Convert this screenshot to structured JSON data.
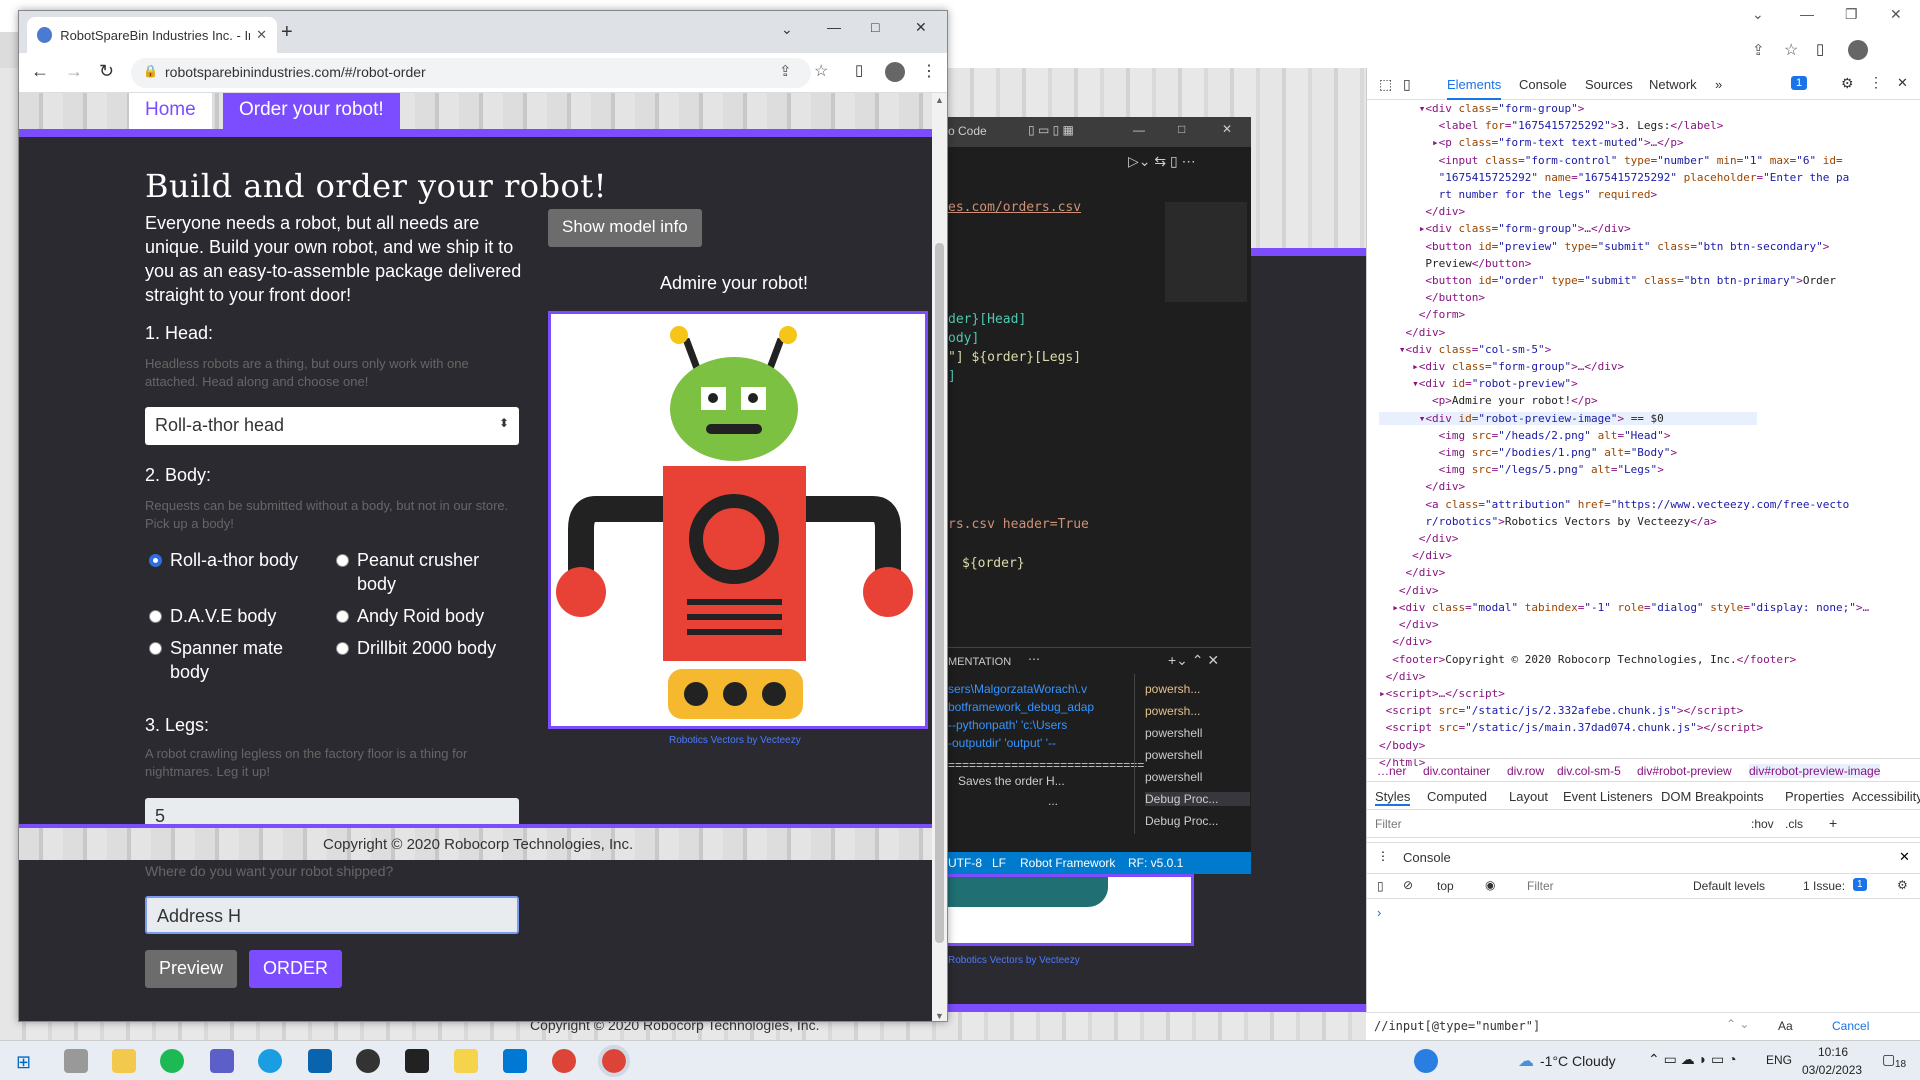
{
  "browser": {
    "tab_title": "RobotSpareBin Industries Inc. - In",
    "url": "robotsparebinindustries.com/#/robot-order",
    "nav_home": "Home",
    "nav_order": "Order your robot!"
  },
  "page": {
    "heading": "Build and order your robot!",
    "intro": "Everyone needs a robot, but all needs are unique. Build your own robot, and we ship it to you as an easy-to-assemble package delivered straight to your front door!",
    "show_model_info": "Show model info",
    "admire": "Admire your robot!",
    "attribution": "Robotics Vectors by Vecteezy",
    "head_label": "1. Head:",
    "head_help": "Headless robots are a thing, but ours only work with one attached. Head along and choose one!",
    "head_selected": "Roll-a-thor head",
    "body_label": "2. Body:",
    "body_help": "Requests can be submitted without a body, but not in our store. Pick up a body!",
    "bodies": [
      {
        "label": "Roll-a-thor body",
        "checked": true
      },
      {
        "label": "Peanut crusher body",
        "checked": false
      },
      {
        "label": "D.A.V.E body",
        "checked": false
      },
      {
        "label": "Andy Roid body",
        "checked": false
      },
      {
        "label": "Spanner mate body",
        "checked": false
      },
      {
        "label": "Drillbit 2000 body",
        "checked": false
      }
    ],
    "legs_label": "3. Legs:",
    "legs_help": "A robot crawling legless on the factory floor is a thing for nightmares. Leg it up!",
    "legs_value": "5",
    "address_help": "Where do you want your robot shipped?",
    "address_value": "Address H",
    "preview": "Preview",
    "order": "ORDER",
    "copyright": "Copyright © 2020 Robocorp Technologies, Inc."
  },
  "vscode": {
    "title": "o Code",
    "lines": [
      "es.com/orders.csv",
      "der}[Head]",
      "ody]",
      "\"]     ${order}[Legs]",
      "]",
      "rs.csv     header=True",
      "${order}"
    ],
    "panel_tab": "MENTATION",
    "terminal": [
      "sers\\MalgorzataWorach\\.v",
      "botframework_debug_adap",
      "--pythonpath' 'c:\\Users",
      "-outputdir' 'output' '--",
      "============================",
      "Saves the order H...",
      "..."
    ],
    "terminals": [
      "powersh...",
      "powersh...",
      "powershell",
      "powershell",
      "powershell",
      "Debug Proc...",
      "Debug Proc..."
    ],
    "status": [
      "UTF-8",
      "LF",
      "Robot Framework",
      "RF: v5.0.1"
    ]
  },
  "devtools": {
    "tabs": [
      "Elements",
      "Console",
      "Sources",
      "Network"
    ],
    "badge": "1",
    "breadcrumb": [
      "…ner",
      "div.container",
      "div.row",
      "div.col-sm-5",
      "div#robot-preview",
      "div#robot-preview-image"
    ],
    "style_tabs": [
      "Styles",
      "Computed",
      "Layout",
      "Event Listeners",
      "DOM Breakpoints",
      "Properties",
      "Accessibility"
    ],
    "filter": "Filter",
    "hov": ":hov",
    "cls": ".cls",
    "console_title": "Console",
    "console_top": "top",
    "console_filter": "Filter",
    "levels": "Default levels",
    "issues": "1 Issue:",
    "issues_n": "1",
    "search_value": "//input[@type=\"number\"]",
    "cancel": "Cancel",
    "aa": "Aa"
  },
  "taskbar": {
    "weather": "-1°C  Cloudy",
    "lang": "ENG",
    "time": "10:16",
    "date": "03/02/2023",
    "notif": "18"
  },
  "colors": {
    "accent": "#7c4dff",
    "page_bg": "#2c2a31",
    "primary": "#7c4dff",
    "secondary": "#6c6c6c"
  }
}
